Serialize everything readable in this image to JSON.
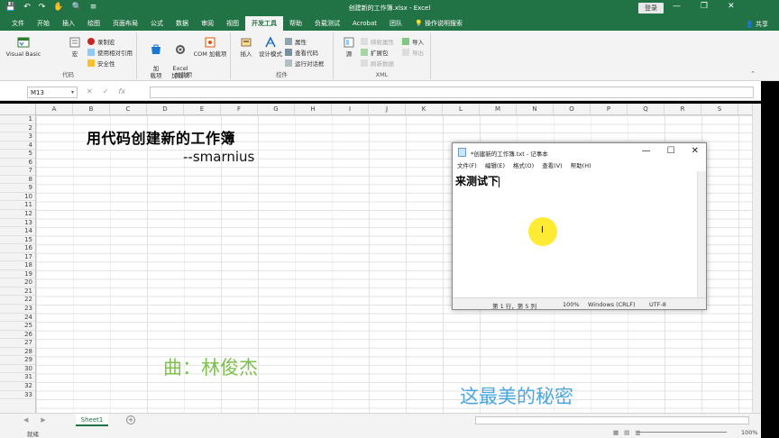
{
  "window": {
    "title": "创建新的工作簿.xlsx  -  Excel",
    "login_label": "登录",
    "qa_icons": [
      "save-icon",
      "undo-icon",
      "redo-icon",
      "touch-icon",
      "print-preview-icon",
      "customize-icon"
    ],
    "controls": [
      "—",
      "❐",
      "✕"
    ]
  },
  "tabs": [
    {
      "label": "文件"
    },
    {
      "label": "开始"
    },
    {
      "label": "插入"
    },
    {
      "label": "绘图"
    },
    {
      "label": "页面布局"
    },
    {
      "label": "公式"
    },
    {
      "label": "数据"
    },
    {
      "label": "审阅"
    },
    {
      "label": "视图"
    },
    {
      "label": "开发工具",
      "active": true
    },
    {
      "label": "帮助"
    },
    {
      "label": "负载测试"
    },
    {
      "label": "Acrobat"
    },
    {
      "label": "团队"
    },
    {
      "label": "操作说明搜索"
    }
  ],
  "share_label": "共享",
  "ribbon": {
    "code": {
      "label": "代码",
      "visual_basic": "Visual Basic",
      "macros": "宏",
      "record_macro": "录制宏",
      "relative_ref": "使用相对引用",
      "macro_security": "安全性"
    },
    "addins": {
      "label": "加载项",
      "addins": "加\n载项",
      "excel_addins": "Excel\n加载项",
      "com_addins": "COM 加载项"
    },
    "controls": {
      "label": "控件",
      "insert": "插入",
      "design_mode": "设计模式",
      "properties": "属性",
      "view_code": "查看代码",
      "run_dialog": "运行对话框"
    },
    "xml": {
      "label": "XML",
      "source": "源",
      "map_properties": "映射属性",
      "expansion_packs": "扩展包",
      "refresh_data": "刷新数据",
      "import": "导入",
      "export": "导出"
    }
  },
  "formula_bar": {
    "name_box": "M13",
    "cancel": "✕",
    "enter": "✓",
    "fx": "fx",
    "value": ""
  },
  "columns": [
    "A",
    "B",
    "C",
    "D",
    "E",
    "F",
    "G",
    "H",
    "I",
    "J",
    "K",
    "L",
    "M",
    "N",
    "O",
    "P",
    "Q",
    "R",
    "S"
  ],
  "rows": [
    "1",
    "2",
    "3",
    "4",
    "5",
    "6",
    "7",
    "8",
    "9",
    "10",
    "11",
    "12",
    "13",
    "14",
    "15",
    "16",
    "17",
    "18",
    "19",
    "20",
    "21",
    "22",
    "23",
    "24",
    "25",
    "26",
    "27",
    "28",
    "29",
    "30",
    "31",
    "32",
    "33"
  ],
  "overlay": {
    "title": "用代码创建新的工作簿",
    "author": "--smarnius",
    "song": "曲：林俊杰",
    "lyric": "这最美的秘密"
  },
  "notepad": {
    "title": "*创建新的工作簿.txt - 记事本",
    "menu": [
      "文件(F)",
      "编辑(E)",
      "格式(O)",
      "查看(V)",
      "帮助(H)"
    ],
    "content": "来测试下",
    "status_pos": "第 1 行，第 5 列",
    "status_zoom": "100%",
    "status_eol": "Windows (CRLF)",
    "status_enc": "UTF-8",
    "controls": [
      "—",
      "☐",
      "✕"
    ]
  },
  "sheet_tabs": {
    "active": "Sheet1",
    "add": "+"
  },
  "status": {
    "ready": "就绪",
    "zoom": "100%"
  },
  "colors": {
    "accent": "#217346",
    "highlight": "#ffe600"
  }
}
